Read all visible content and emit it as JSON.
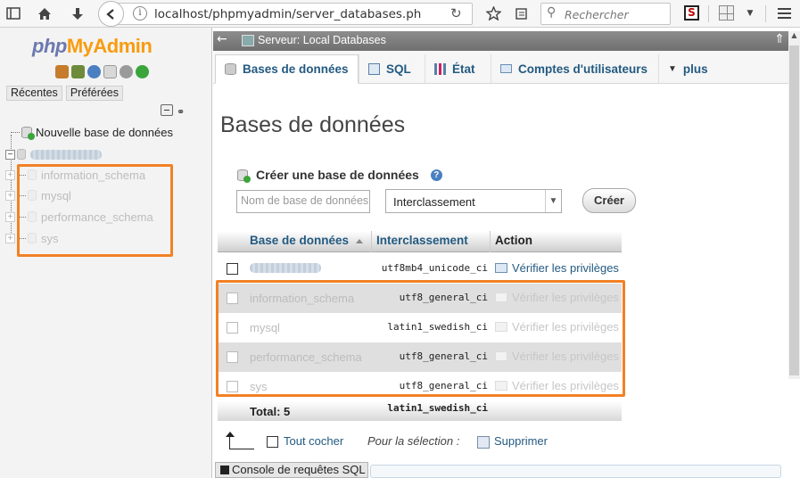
{
  "browser": {
    "url": "localhost/phpmyadmin/server_databases.php?ser",
    "search_placeholder": "Rechercher",
    "ext_s_label": "S"
  },
  "nav": {
    "logo_php": "php",
    "logo_my": "My",
    "logo_admin": "Admin",
    "tabs": [
      "Récentes",
      "Préférées"
    ],
    "new_db_label": "Nouvelle base de données",
    "databases": [
      "information_schema",
      "mysql",
      "performance_schema",
      "sys"
    ]
  },
  "main": {
    "server_label": "Serveur: Local Databases",
    "tabs": [
      {
        "label": "Bases de données",
        "icon": "database-icon"
      },
      {
        "label": "SQL",
        "icon": "sql-icon"
      },
      {
        "label": "État",
        "icon": "status-icon"
      },
      {
        "label": "Comptes d'utilisateurs",
        "icon": "users-icon"
      },
      {
        "label": "plus",
        "icon": "dropdown-arrow-icon"
      }
    ],
    "page_title": "Bases de données",
    "create_title": "Créer une base de données",
    "dbname_placeholder": "Nom de base de données",
    "collation_value": "Interclassement",
    "create_button": "Créer",
    "table": {
      "headers": [
        "Base de données",
        "Interclassement",
        "Action"
      ],
      "rows": [
        {
          "name": "",
          "collation": "utf8mb4_unicode_ci",
          "action": "Vérifier les privilèges",
          "faded": false,
          "redacted": true
        },
        {
          "name": "information_schema",
          "collation": "utf8_general_ci",
          "action": "Vérifier les privilèges",
          "faded": true
        },
        {
          "name": "mysql",
          "collation": "latin1_swedish_ci",
          "action": "Vérifier les privilèges",
          "faded": true
        },
        {
          "name": "performance_schema",
          "collation": "utf8_general_ci",
          "action": "Vérifier les privilèges",
          "faded": true
        },
        {
          "name": "sys",
          "collation": "utf8_general_ci",
          "action": "Vérifier les privilèges",
          "faded": true
        }
      ],
      "total_label": "Total: 5",
      "total_collation": "latin1_swedish_ci"
    },
    "selection": {
      "check_all": "Tout cocher",
      "for_selection": "Pour la sélection :",
      "delete": "Supprimer"
    },
    "console_label": "Console de requêtes SQL"
  },
  "colors": {
    "highlight": "#f28125",
    "link": "#235a81",
    "server_bar": "#7a7a7a"
  }
}
